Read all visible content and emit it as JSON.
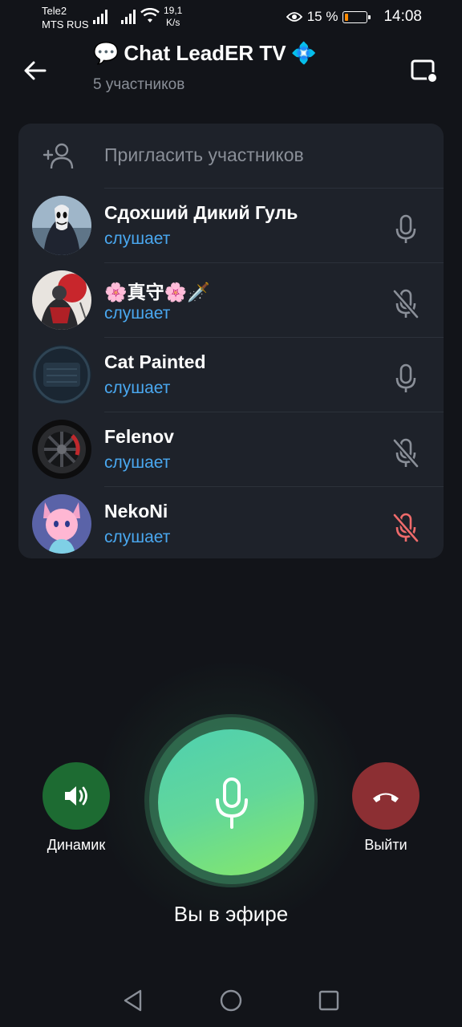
{
  "status_bar": {
    "carrier1": "Tele2",
    "carrier2": "MTS RUS",
    "net_speed_value": "19,1",
    "net_speed_unit": "K/s",
    "battery_percent": "15 %",
    "battery_level": 0.15,
    "time": "14:08"
  },
  "header": {
    "title_emoji": "💬",
    "title": "Chat LeadER TV",
    "title_badge": "💠",
    "subtitle": "5 участников"
  },
  "invite": {
    "label": "Пригласить участников"
  },
  "participants": [
    {
      "name": "Сдохший Дикий Гуль",
      "status": "слушает",
      "mic": "enabled"
    },
    {
      "name": "🌸真守🌸🗡️",
      "status": "слушает",
      "mic": "muted"
    },
    {
      "name": "Cat Painted",
      "status": "слушает",
      "mic": "enabled"
    },
    {
      "name": "Felenov",
      "status": "слушает",
      "mic": "muted"
    },
    {
      "name": "NekoNi",
      "status": "слушает",
      "mic": "muted-red"
    }
  ],
  "controls": {
    "speaker_label": "Динамик",
    "leave_label": "Выйти",
    "on_air_label": "Вы в эфире"
  },
  "colors": {
    "background": "#121419",
    "card": "#1e222a",
    "status_blue": "#4aa8f0",
    "speaker_green": "#1d6b32",
    "leave_red": "#8c2f33",
    "muted_red": "#ef6b6b"
  }
}
